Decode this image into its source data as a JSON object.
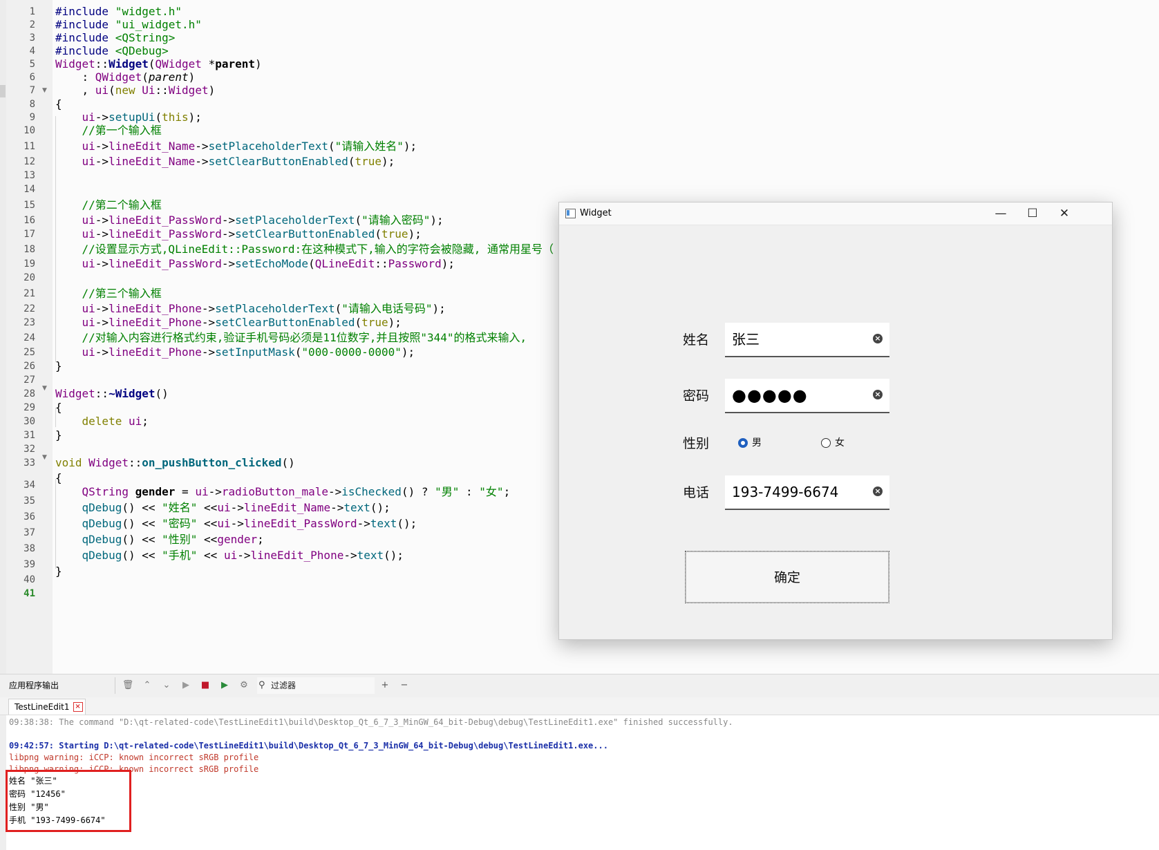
{
  "editor": {
    "line_numbers": [
      "1",
      "2",
      "3",
      "4",
      "5",
      "6",
      "7",
      "8",
      "9",
      "10",
      "11",
      "12",
      "13",
      "14",
      "15",
      "16",
      "17",
      "18",
      "19",
      "20",
      "21",
      "22",
      "23",
      "24",
      "25",
      "26",
      "27",
      "28",
      "29",
      "30",
      "31",
      "32",
      "33",
      "34",
      "35",
      "36",
      "37",
      "38",
      "39",
      "40",
      "41"
    ],
    "active_line": "41"
  },
  "widget": {
    "title": "Widget",
    "min_symbol": "—",
    "max_symbol": "☐",
    "close_symbol": "✕",
    "name_label": "姓名",
    "name_value": "张三",
    "password_label": "密码",
    "password_value": "●●●●●",
    "gender_label": "性别",
    "male_label": "男",
    "female_label": "女",
    "male_checked": true,
    "phone_label": "电话",
    "phone_value": "193-7499-6674",
    "clear_symbol": "×",
    "ok_label": "确定"
  },
  "output": {
    "title": "应用程序输出",
    "filter_label": "过滤器",
    "tab_label": "TestLineEdit1",
    "lines": [
      "09:38:38: The command \"D:\\qt-related-code\\TestLineEdit1\\build\\Desktop_Qt_6_7_3_MinGW_64_bit-Debug\\debug\\TestLineEdit1.exe\" finished successfully.",
      "09:42:57: Starting D:\\qt-related-code\\TestLineEdit1\\build\\Desktop_Qt_6_7_3_MinGW_64_bit-Debug\\debug\\TestLineEdit1.exe...",
      "libpng warning: iCCP: known incorrect sRGB profile",
      "libpng warning: iCCP: known incorrect sRGB profile",
      "姓名 \"张三\"",
      "密码 \"12456\"",
      "性别 \"男\"",
      "手机 \"193-7499-6674\""
    ]
  },
  "colors": {
    "keyword": "#808000",
    "string": "#008000",
    "type": "#800080",
    "function": "#00677c",
    "highlight_box": "#e02020",
    "radio_checked": "#1f5fbf"
  }
}
